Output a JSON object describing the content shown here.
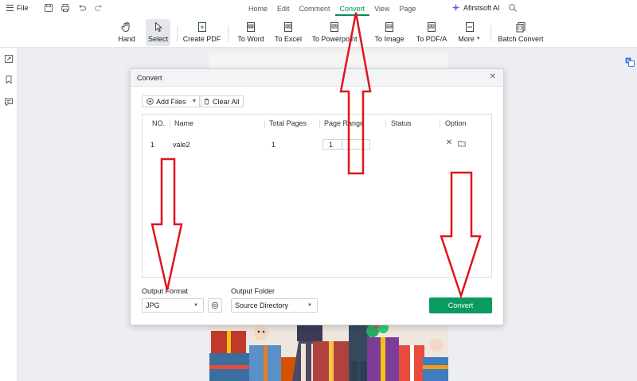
{
  "menubar": {
    "file_label": "File",
    "quick_icons": [
      "save-icon",
      "print-icon",
      "undo-icon",
      "redo-icon"
    ],
    "tabs": [
      {
        "label": "Home",
        "active": false
      },
      {
        "label": "Edit",
        "active": false
      },
      {
        "label": "Comment",
        "active": false
      },
      {
        "label": "Convert",
        "active": true
      },
      {
        "label": "View",
        "active": false
      },
      {
        "label": "Page",
        "active": false
      }
    ],
    "ai_label": "Afirstsoft AI"
  },
  "toolbar": {
    "tools": [
      {
        "label": "Hand",
        "icon": "hand-icon"
      },
      {
        "label": "Select",
        "icon": "cursor-icon",
        "active": true
      },
      {
        "label": "Create PDF",
        "icon": "create-pdf-icon"
      },
      {
        "label": "To Word",
        "icon": "word-icon"
      },
      {
        "label": "To Excel",
        "icon": "excel-icon"
      },
      {
        "label": "To Powerpoint",
        "icon": "powerpoint-icon"
      },
      {
        "label": "To Image",
        "icon": "image-icon"
      },
      {
        "label": "To PDF/A",
        "icon": "pdfa-icon"
      },
      {
        "label": "More",
        "icon": "more-icon"
      },
      {
        "label": "Batch Convert",
        "icon": "batch-icon"
      }
    ]
  },
  "dialog": {
    "title": "Convert",
    "add_files_label": "Add Files",
    "clear_all_label": "Clear All",
    "columns": [
      "NO.",
      "Name",
      "Total Pages",
      "Page Range",
      "Status",
      "Option"
    ],
    "rows": [
      {
        "no": "1",
        "name": "vale2",
        "total_pages": "1",
        "page_range_from": "1",
        "page_range_to": "",
        "status": ""
      }
    ],
    "output_format_label": "Output Format",
    "output_format_value": "JPG",
    "output_folder_label": "Output Folder",
    "output_folder_value": "Source Directory",
    "convert_label": "Convert"
  },
  "colors": {
    "accent": "#0a8a5a",
    "convert_button": "#0b9a62",
    "annotation_arrow": "#e0141e"
  }
}
